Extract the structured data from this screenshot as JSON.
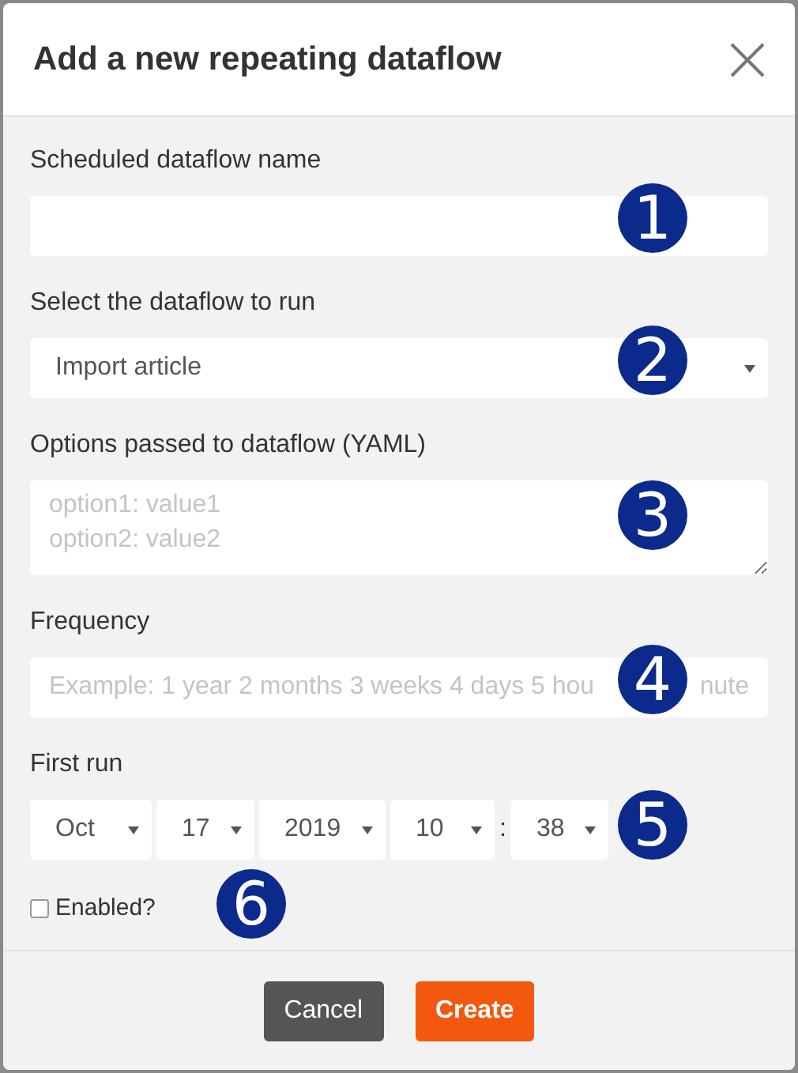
{
  "dialog": {
    "title": "Add a new repeating dataflow"
  },
  "fields": [
    {
      "kind": "text",
      "label": "Scheduled dataflow name",
      "callout": "1"
    },
    {
      "kind": "select",
      "label": "Select the dataflow to run",
      "value": "Import article",
      "callout": "2"
    },
    {
      "kind": "textarea",
      "label": "Options passed to dataflow (YAML)",
      "placeholder": "option1: value1\noption2: value2",
      "callout": "3"
    },
    {
      "kind": "text",
      "label": "Frequency",
      "placeholder": "Example: 1 year 2 months 3 weeks 4 days 5 hou",
      "placeholder_tail": "nute",
      "callout": "4"
    },
    {
      "kind": "datetime",
      "label": "First run",
      "parts": [
        {
          "value": "Oct"
        },
        {
          "value": "17"
        },
        {
          "value": "2019"
        },
        {
          "value": "10"
        },
        {
          "value": "38",
          "separator": ":"
        }
      ],
      "callout": "5"
    }
  ],
  "enabled": {
    "label": "Enabled?",
    "checked": false,
    "callout": "6"
  },
  "buttons": [
    {
      "label": "Cancel",
      "kind": "secondary"
    },
    {
      "label": "Create",
      "kind": "primary"
    }
  ]
}
